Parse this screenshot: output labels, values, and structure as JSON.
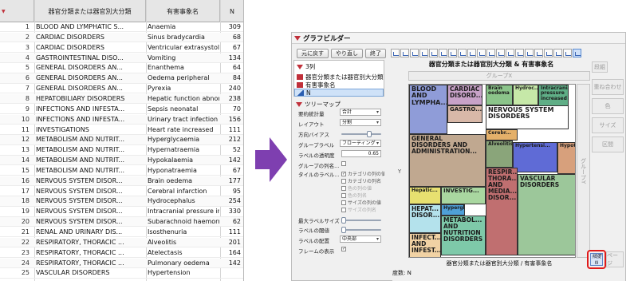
{
  "table": {
    "headers": {
      "a": "器官分類または器官別大分類",
      "b": "有害事象名",
      "n": "N"
    },
    "rows": [
      {
        "num": "1",
        "a": "BLOOD AND LYMPHATIC S...",
        "b": "Anaemia",
        "n": "309"
      },
      {
        "num": "2",
        "a": "CARDIAC DISORDERS",
        "b": "Sinus bradycardia",
        "n": "68"
      },
      {
        "num": "3",
        "a": "CARDIAC DISORDERS",
        "b": "Ventricular extrasystoles",
        "n": "67"
      },
      {
        "num": "4",
        "a": "GASTROINTESTINAL DISO...",
        "b": "Vomiting",
        "n": "134"
      },
      {
        "num": "5",
        "a": "GENERAL DISORDERS AN...",
        "b": "Enanthema",
        "n": "64"
      },
      {
        "num": "6",
        "a": "GENERAL DISORDERS AN...",
        "b": "Oedema peripheral",
        "n": "84"
      },
      {
        "num": "7",
        "a": "GENERAL DISORDERS AN...",
        "b": "Pyrexia",
        "n": "240"
      },
      {
        "num": "8",
        "a": "HEPATOBILIARY DISORDERS",
        "b": "Hepatic function abnormal",
        "n": "238"
      },
      {
        "num": "9",
        "a": "INFECTIONS AND INFESTA...",
        "b": "Sepsis neonatal",
        "n": "70"
      },
      {
        "num": "10",
        "a": "INFECTIONS AND INFESTA...",
        "b": "Urinary tract infection",
        "n": "156"
      },
      {
        "num": "11",
        "a": "INVESTIGATIONS",
        "b": "Heart rate increased",
        "n": "111"
      },
      {
        "num": "12",
        "a": "METABOLISM AND NUTRIT...",
        "b": "Hyperglycaemia",
        "n": "212"
      },
      {
        "num": "13",
        "a": "METABOLISM AND NUTRIT...",
        "b": "Hypernatraemia",
        "n": "52"
      },
      {
        "num": "14",
        "a": "METABOLISM AND NUTRIT...",
        "b": "Hypokalaemia",
        "n": "142"
      },
      {
        "num": "15",
        "a": "METABOLISM AND NUTRIT...",
        "b": "Hyponatraemia",
        "n": "67"
      },
      {
        "num": "16",
        "a": "NERVOUS SYSTEM DISOR...",
        "b": "Brain oedema",
        "n": "177"
      },
      {
        "num": "17",
        "a": "NERVOUS SYSTEM DISOR...",
        "b": "Cerebral infarction",
        "n": "95"
      },
      {
        "num": "18",
        "a": "NERVOUS SYSTEM DISOR...",
        "b": "Hydrocephalus",
        "n": "254"
      },
      {
        "num": "19",
        "a": "NERVOUS SYSTEM DISOR...",
        "b": "Intracranial pressure increased",
        "n": "330"
      },
      {
        "num": "20",
        "a": "NERVOUS SYSTEM DISOR...",
        "b": "Subarachnoid haemorrhage",
        "n": "62"
      },
      {
        "num": "21",
        "a": "RENAL AND URINARY DIS...",
        "b": "Isosthenuria",
        "n": "111"
      },
      {
        "num": "22",
        "a": "RESPIRATORY, THORACIC ...",
        "b": "Alveolitis",
        "n": "201"
      },
      {
        "num": "23",
        "a": "RESPIRATORY, THORACIC ...",
        "b": "Atelectasis",
        "n": "164"
      },
      {
        "num": "24",
        "a": "RESPIRATORY, THORACIC ...",
        "b": "Pulmonary oedema",
        "n": "142"
      },
      {
        "num": "25",
        "a": "VASCULAR DISORDERS",
        "b": "Hypertension",
        "n": ""
      }
    ]
  },
  "graph_builder": {
    "window_title": "グラフビルダー",
    "buttons": {
      "undo": "元に戻す",
      "redo": "やり直し",
      "done": "終了"
    },
    "variables": {
      "header": "3列",
      "items": [
        "器官分類または器官別大分類",
        "有害事象名",
        "N"
      ]
    },
    "treemap": {
      "header": "ツリーマップ",
      "summary_stat_label": "要約統計量",
      "summary_stat_value": "合計",
      "layout_label": "レイアウト",
      "layout_value": "分割",
      "bias_label": "方向バイアス",
      "group_label_label": "グループラベル",
      "group_label_value": "フローティング",
      "label_opacity_label": "ラベルの透明度",
      "label_opacity_value": "0.65",
      "group_col_label": "グループの列名...",
      "tile_label_label": "タイルのラベル...",
      "checks": [
        "カテゴリの列の値",
        "カテゴリの列名",
        "色の列の値",
        "色の列名",
        "サイズの列の値",
        "サイズの列名"
      ],
      "max_label_size_label": "最大ラベルサイズ",
      "label_threshold_label": "ラベルの閾値",
      "label_position_label": "ラベルの配置",
      "label_position_value": "中央部",
      "frame_label": "フレームの表示"
    },
    "plot": {
      "title": "器官分類または器官別大分類 & 有害事象名",
      "group_x": "グループX",
      "group_y": "グループY",
      "y_zone": "Y",
      "x_title": "器官分類または器官別大分類 / 有害事象名",
      "freq_label": "度数: N",
      "right_zones": [
        "段組",
        "重ね合わせ",
        "色",
        "サイズ",
        "区間"
      ],
      "size_zone": {
        "label": "頻度",
        "value": "N"
      },
      "page_zone": "ページ",
      "tiles": [
        {
          "label": "BLOOD AND LYMPHA...",
          "color": "#8f9cd8",
          "fs": "8"
        },
        {
          "label": "CARDIAC DISORD...",
          "color": "#c8a2c8",
          "fs": "7.5"
        },
        {
          "label": "GASTRO...",
          "color": "#d8b8a8",
          "fs": "7"
        },
        {
          "label": "Brain oedema",
          "color": "#8bc48a",
          "fs": "6"
        },
        {
          "label": "Hydroc...",
          "color": "#c6e8a8",
          "fs": "6"
        },
        {
          "label": "Intracranial pressure increased",
          "color": "#5fae86",
          "fs": "6"
        },
        {
          "label": "NERVOUS SYSTEM DISORDERS",
          "color": "#ffffff",
          "fs": "8"
        },
        {
          "label": "Cerebr...",
          "color": "#e4b06a",
          "fs": "6"
        },
        {
          "label": "GENERAL DISORDERS AND ADMINISTRATION...",
          "color": "#c0a890",
          "fs": "7.5"
        },
        {
          "label": "Alveolitis",
          "color": "#8aa57a",
          "fs": "6"
        },
        {
          "label": "Hypertensi...",
          "color": "#5f6bd6",
          "fs": "6"
        },
        {
          "label": "Hypotension",
          "color": "#d7a07c",
          "fs": "6"
        },
        {
          "label": "Hepatic...",
          "color": "#e7e070",
          "fs": "6"
        },
        {
          "label": "HEPAT... DISOR...",
          "color": "#b4e2ec",
          "fs": "7.5"
        },
        {
          "label": "INVESTIG...",
          "color": "#a9d7a0",
          "fs": "7"
        },
        {
          "label": "Hyperglycae...",
          "color": "#4fa0d8",
          "fs": "6"
        },
        {
          "label": "METABOL... AND NUTRITION DISORDERS",
          "color": "#7ec9a9",
          "fs": "7.5"
        },
        {
          "label": "RESPIR... THORA... AND MEDIA... DISOR...",
          "color": "#c06f70",
          "fs": "7.5"
        },
        {
          "label": "VASCULAR DISORDERS",
          "color": "#9cc79a",
          "fs": "7.5"
        },
        {
          "label": "INFECT... AND INFEST...",
          "color": "#f1d2a4",
          "fs": "7.5"
        }
      ]
    }
  }
}
